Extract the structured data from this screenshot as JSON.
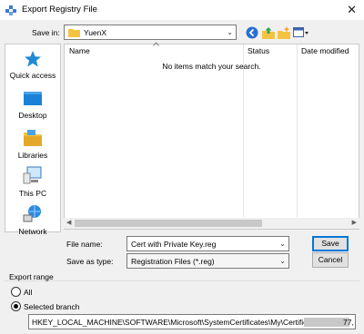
{
  "window": {
    "title": "Export Registry File",
    "close_glyph": "✕",
    "app_icon": "regedit-icon"
  },
  "save_in": {
    "label": "Save in:",
    "value": "YuenX",
    "folder_icon": "folder-icon"
  },
  "toolbar": {
    "icons": [
      "back-icon",
      "up-folder-icon",
      "new-folder-icon",
      "view-menu-icon"
    ]
  },
  "places": [
    {
      "label": "Quick access",
      "icon": "star-icon"
    },
    {
      "label": "Desktop",
      "icon": "desktop-icon"
    },
    {
      "label": "Libraries",
      "icon": "libraries-icon"
    },
    {
      "label": "This PC",
      "icon": "computer-icon"
    },
    {
      "label": "Network",
      "icon": "network-icon"
    }
  ],
  "file_list": {
    "columns": [
      "Name",
      "Status",
      "Date modified"
    ],
    "empty_message": "No items match your search."
  },
  "file_name": {
    "label": "File name:",
    "value": "Cert with Private Key.reg"
  },
  "save_as_type": {
    "label": "Save as type:",
    "value": "Registration Files (*.reg)"
  },
  "buttons": {
    "save": "Save",
    "cancel": "Cancel"
  },
  "export_range": {
    "label": "Export range",
    "option_all": "All",
    "option_selected": "Selected branch",
    "selected": "Selected branch",
    "branch_path": "HKEY_LOCAL_MACHINE\\SOFTWARE\\Microsoft\\SystemCertificates\\My\\Certificates\\3A50",
    "branch_tail": "77,"
  },
  "colors": {
    "accent": "#0078d7",
    "folder": "#f5c342"
  }
}
